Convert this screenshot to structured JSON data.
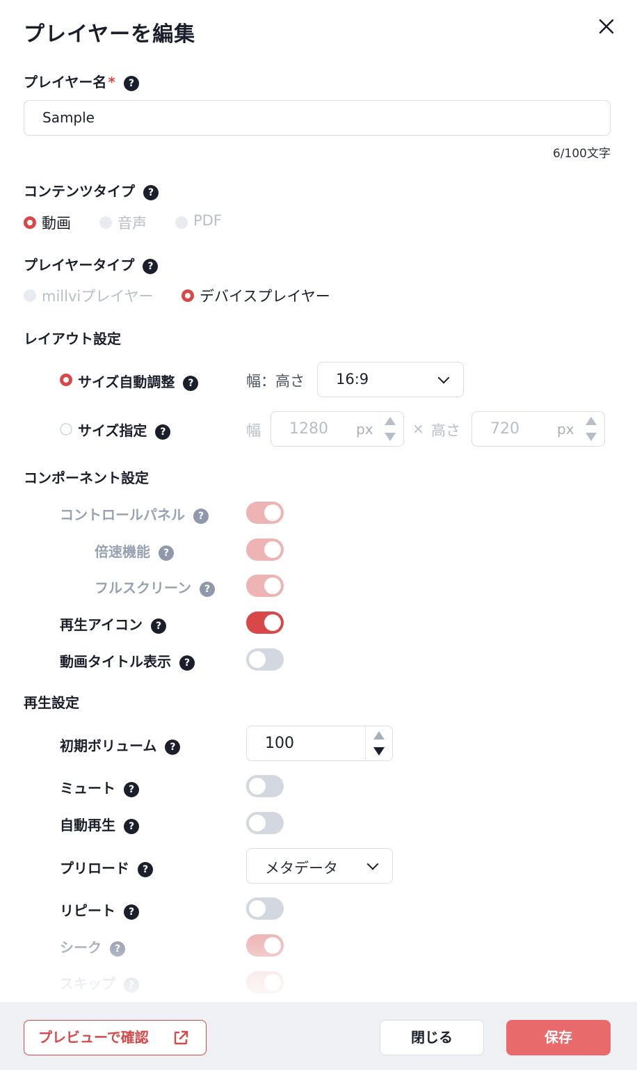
{
  "dialog": {
    "title": "プレイヤーを編集",
    "close_label": "×"
  },
  "player_name": {
    "label": "プレイヤー名",
    "required_mark": "*",
    "value": "Sample",
    "counter": "6/100文字"
  },
  "content_type": {
    "label": "コンテンツタイプ",
    "options": [
      "動画",
      "音声",
      "PDF"
    ],
    "selected": "動画"
  },
  "player_type": {
    "label": "プレイヤータイプ",
    "options": [
      "millviプレイヤー",
      "デバイスプレイヤー"
    ],
    "selected": "デバイスプレイヤー"
  },
  "layout": {
    "label": "レイアウト設定",
    "auto_size": {
      "label": "サイズ自動調整",
      "ratio_label": "幅：高さ",
      "ratio_value": "16:9"
    },
    "fixed_size": {
      "label": "サイズ指定",
      "width_label": "幅",
      "width_value": "1280",
      "width_unit": "px",
      "times": "×",
      "height_label": "高さ",
      "height_value": "720",
      "height_unit": "px"
    }
  },
  "components": {
    "label": "コンポーネント設定",
    "control_panel": "コントロールパネル",
    "speed": "倍速機能",
    "fullscreen": "フルスクリーン",
    "play_icon": "再生アイコン",
    "video_title": "動画タイトル表示"
  },
  "playback": {
    "label": "再生設定",
    "initial_volume": "初期ボリューム",
    "volume_value": "100",
    "mute": "ミュート",
    "autoplay": "自動再生",
    "preload": "プリロード",
    "preload_value": "メタデータ",
    "repeat": "リピート",
    "seek": "シーク",
    "skip": "スキップ"
  },
  "footer": {
    "preview": "プレビューで確認",
    "close": "閉じる",
    "save": "保存"
  },
  "colors": {
    "accent": "#d94848",
    "save_button": "#e86a6a"
  }
}
